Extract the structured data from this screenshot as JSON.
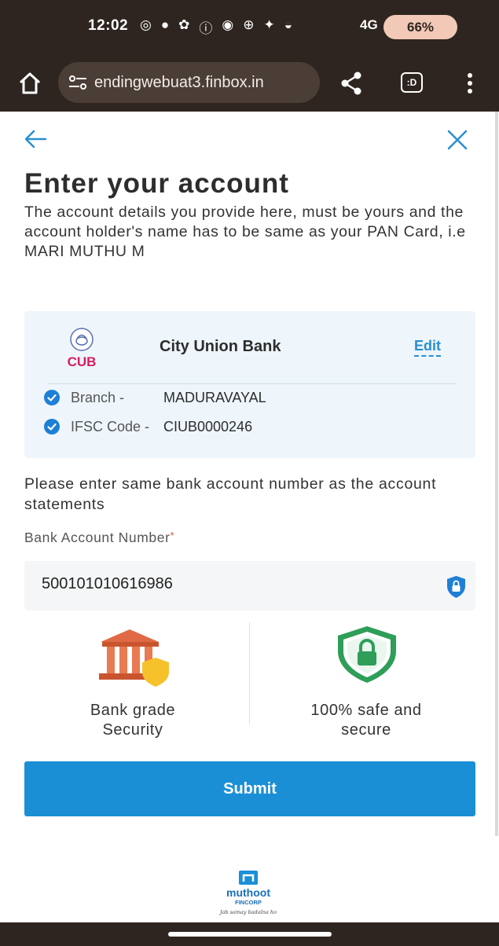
{
  "status_bar": {
    "time": "12:02",
    "notification_icons": [
      "whatsapp-icon",
      "chat-icon",
      "app-icon",
      "info-icon",
      "message-icon",
      "globe-icon",
      "bird-icon",
      "weather-icon"
    ],
    "network": "4G",
    "battery": "66%"
  },
  "browser": {
    "url": "endingwebuat3.finbox.in",
    "tabs_label": ":D"
  },
  "page": {
    "title": "Enter your account",
    "description": "The account details you provide here, must be yours and the account holder's name has to be same as your PAN Card, i.e MARI MUTHU M",
    "bank": {
      "logo_text": "CUB",
      "name": "City Union Bank",
      "edit_label": "Edit",
      "branch_label": "Branch -",
      "branch_value": "MADURAVAYAL",
      "ifsc_label": "IFSC Code -",
      "ifsc_value": "CIUB0000246"
    },
    "instruction": "Please enter same bank account number as the account statements",
    "account_field": {
      "label": "Bank Account Number",
      "required_mark": "*",
      "value": "500101010616986"
    },
    "features": {
      "left_line1": "Bank grade",
      "left_line2": "Security",
      "right_line1": "100% safe and",
      "right_line2": "secure"
    },
    "submit_label": "Submit",
    "footer": {
      "brand": "muthoot",
      "sub": "FINCORP",
      "tagline": "Jab samay badalna ho"
    }
  },
  "colors": {
    "accent": "#1a8fd6",
    "link": "#2a8fd0",
    "card_bg": "#eef6fb",
    "bank_icon": "#e06a45",
    "shield": "#2e9e58"
  }
}
